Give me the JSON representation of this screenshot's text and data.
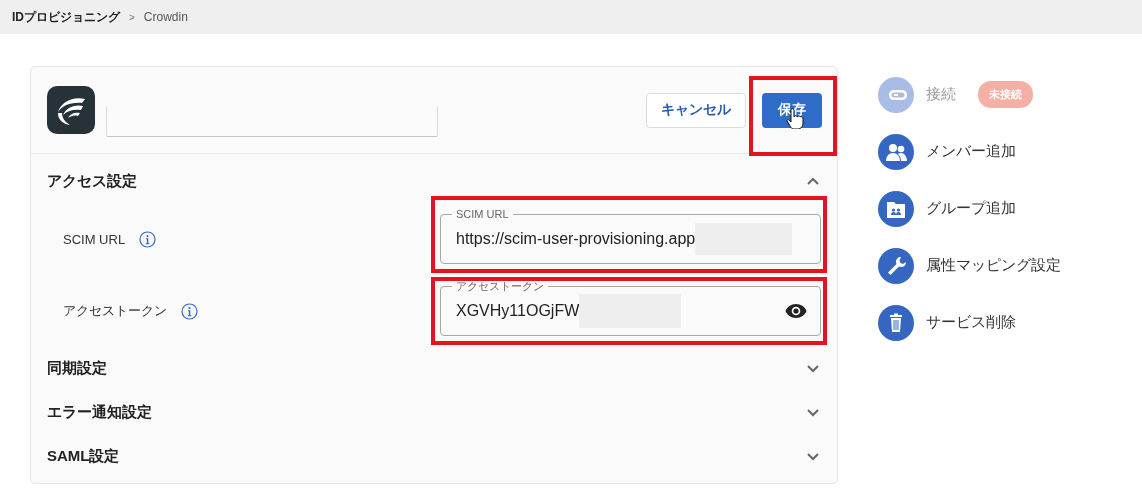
{
  "breadcrumb": {
    "separator": ">",
    "items": [
      {
        "label": "IDプロビジョニング"
      },
      {
        "label": "Crowdin"
      }
    ]
  },
  "buttons": [
    {
      "label": "キャンセル",
      "kind": "secondary"
    },
    {
      "label": "保存",
      "kind": "primary"
    }
  ],
  "sections": [
    {
      "title": "アクセス設定",
      "expanded": true,
      "fields": [
        {
          "label": "SCIM URL",
          "field_label": "SCIM URL",
          "value": "https://scim-user-provisioning.app",
          "kind": "text"
        },
        {
          "label": "アクセストークン",
          "field_label": "アクセストークン",
          "value": "XGVHy11OGjFW",
          "kind": "secret"
        }
      ]
    },
    {
      "title": "同期設定",
      "expanded": false
    },
    {
      "title": "エラー通知設定",
      "expanded": false
    },
    {
      "title": "SAML設定",
      "expanded": false
    }
  ],
  "actions": [
    {
      "label": "接続",
      "kind": "link",
      "disabled": true,
      "badge": "未接続"
    },
    {
      "label": "メンバー追加",
      "kind": "people",
      "disabled": false
    },
    {
      "label": "グループ追加",
      "kind": "group",
      "disabled": false
    },
    {
      "label": "属性マッピング設定",
      "kind": "wrench",
      "disabled": false
    },
    {
      "label": "サービス削除",
      "kind": "trash",
      "disabled": false
    }
  ]
}
